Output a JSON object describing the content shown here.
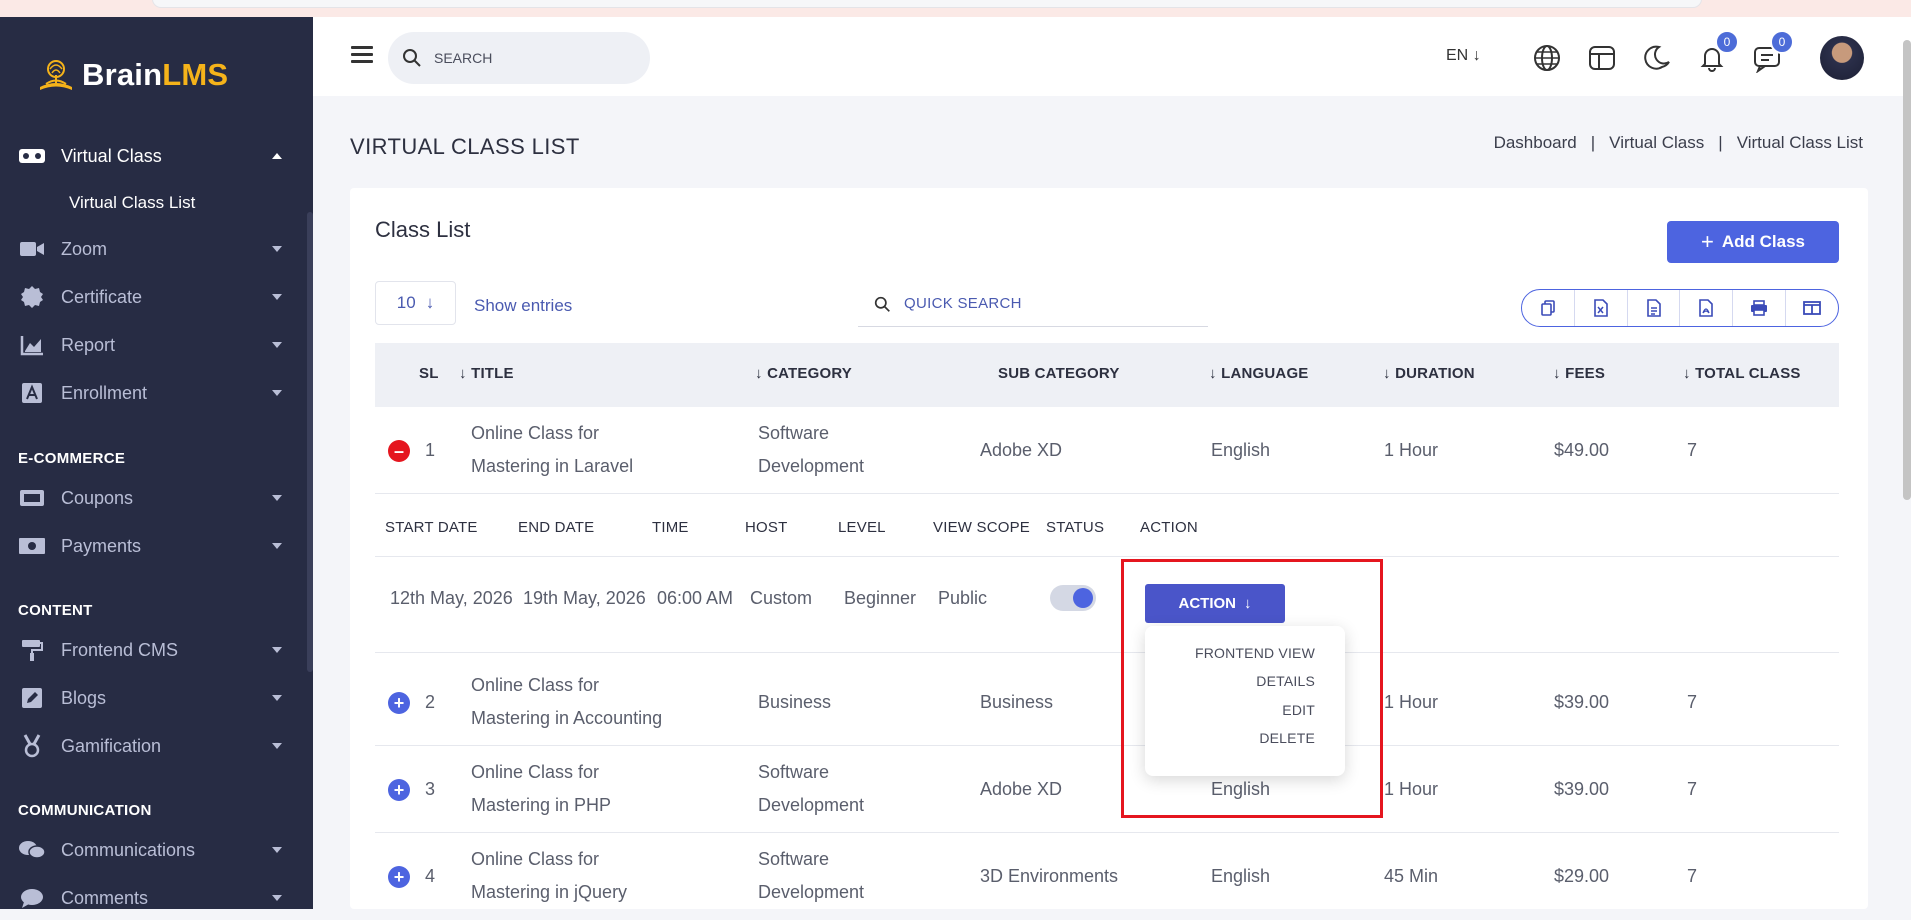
{
  "sidebar": {
    "logo": {
      "prefix": "Brain",
      "suffix": "LMS"
    },
    "items": [
      {
        "label": "Virtual Class",
        "icon": "vr-headset-icon"
      },
      {
        "label": "Zoom",
        "icon": "video-camera-icon"
      },
      {
        "label": "Certificate",
        "icon": "certificate-badge-icon"
      },
      {
        "label": "Report",
        "icon": "chart-icon"
      },
      {
        "label": "Enrollment",
        "icon": "enrollment-icon"
      },
      {
        "label": "Coupons",
        "icon": "coupon-icon"
      },
      {
        "label": "Payments",
        "icon": "money-icon"
      },
      {
        "label": "Frontend CMS",
        "icon": "paint-roller-icon"
      },
      {
        "label": "Blogs",
        "icon": "pencil-icon"
      },
      {
        "label": "Gamification",
        "icon": "medal-icon"
      },
      {
        "label": "Communications",
        "icon": "chat-bubbles-icon"
      },
      {
        "label": "Comments",
        "icon": "comment-icon"
      }
    ],
    "sub_item": "Virtual Class List",
    "sections": {
      "ecommerce": "E-COMMERCE",
      "content": "CONTENT",
      "communication": "COMMUNICATION"
    }
  },
  "header": {
    "search_placeholder": "SEARCH",
    "language": "EN",
    "notifications_count": "0",
    "messages_count": "0"
  },
  "page": {
    "title": "VIRTUAL CLASS LIST",
    "breadcrumbs": [
      "Dashboard",
      "Virtual Class",
      "Virtual Class List"
    ]
  },
  "card": {
    "title": "Class List",
    "add_button": "Add Class",
    "entries_value": "10",
    "show_entries": "Show entries",
    "quick_search": "QUICK SEARCH"
  },
  "table": {
    "columns": [
      "SL",
      "TITLE",
      "CATEGORY",
      "SUB CATEGORY",
      "LANGUAGE",
      "DURATION",
      "FEES",
      "TOTAL CLASS"
    ],
    "rows": [
      {
        "sl": "1",
        "title1": "Online Class for",
        "title2": "Mastering in Laravel",
        "cat1": "Software",
        "cat2": "Development",
        "sub": "Adobe XD",
        "lang": "English",
        "dur": "1 Hour",
        "fees": "$49.00",
        "total": "7"
      },
      {
        "sl": "2",
        "title1": "Online Class for",
        "title2": "Mastering in Accounting",
        "cat1": "Business",
        "cat2": "",
        "sub": "Business",
        "lang": "",
        "dur": "1 Hour",
        "fees": "$39.00",
        "total": "7"
      },
      {
        "sl": "3",
        "title1": "Online Class for",
        "title2": "Mastering in PHP",
        "cat1": "Software",
        "cat2": "Development",
        "sub": "Adobe XD",
        "lang": "English",
        "dur": "1 Hour",
        "fees": "$39.00",
        "total": "7"
      },
      {
        "sl": "4",
        "title1": "Online Class for",
        "title2": "Mastering in jQuery",
        "cat1": "Software",
        "cat2": "Development",
        "sub": "3D Environments",
        "lang": "English",
        "dur": "45 Min",
        "fees": "$29.00",
        "total": "7"
      }
    ],
    "detail_columns": [
      "START DATE",
      "END DATE",
      "TIME",
      "HOST",
      "LEVEL",
      "VIEW SCOPE",
      "STATUS",
      "ACTION"
    ],
    "detail_values": {
      "start": "12th May, 2026",
      "end": "19th May, 2026",
      "time": "06:00 AM",
      "host": "Custom",
      "level": "Beginner",
      "scope": "Public"
    },
    "action_button": "ACTION",
    "action_menu": [
      "FRONTEND VIEW",
      "DETAILS",
      "EDIT",
      "DELETE"
    ]
  },
  "colors": {
    "accent": "#4d64e0",
    "sidebar": "#272c44",
    "logo_accent": "#f5b31a",
    "highlight": "#e5161f"
  }
}
